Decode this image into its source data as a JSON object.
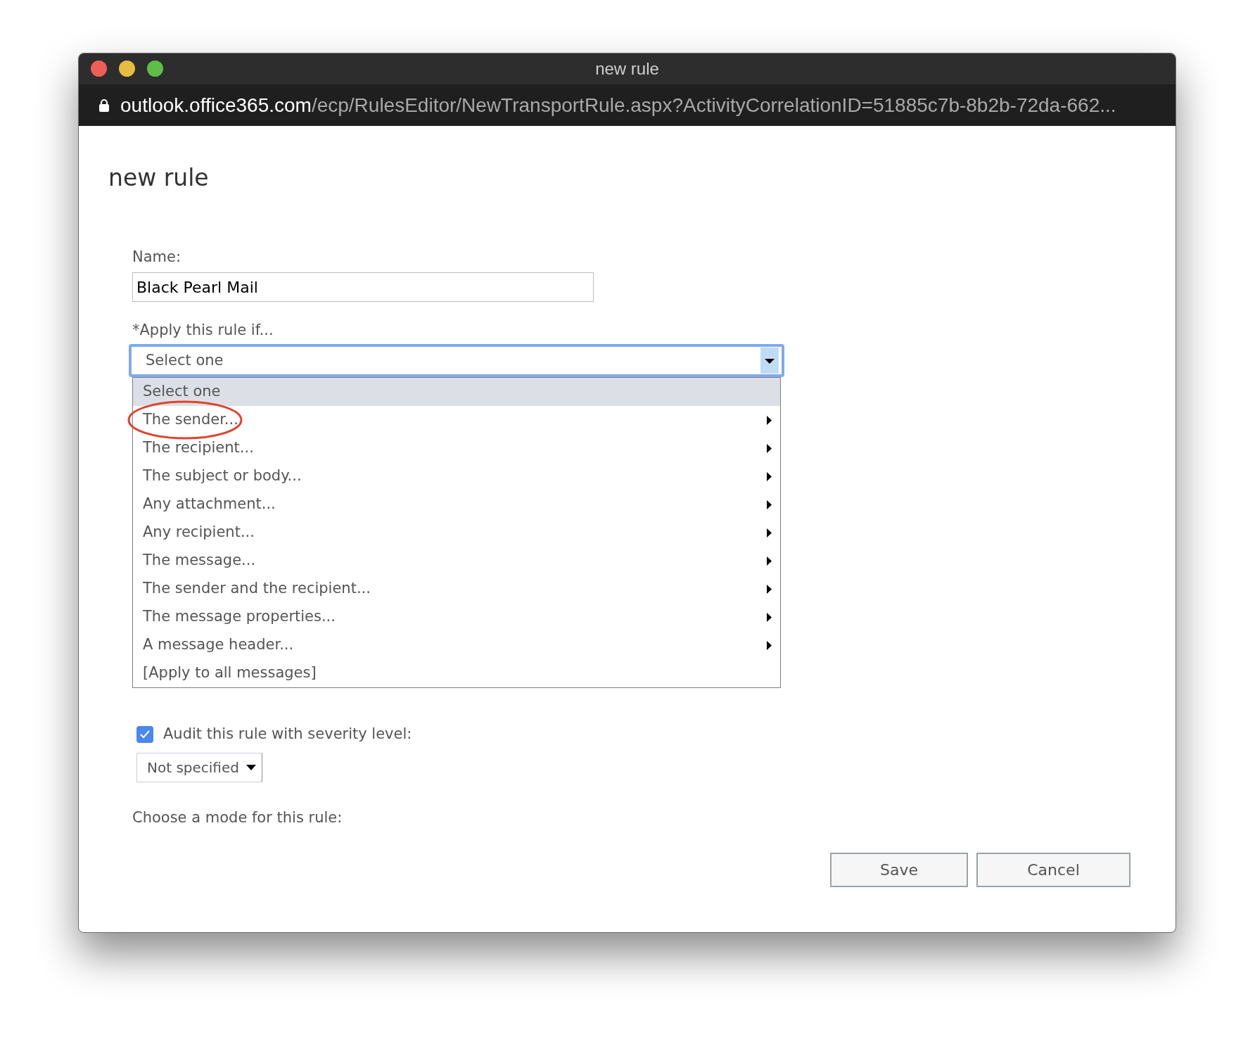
{
  "window": {
    "title": "new rule",
    "url_host": "outlook.office365.com",
    "url_path": "/ecp/RulesEditor/NewTransportRule.aspx?ActivityCorrelationID=51885c7b-8b2b-72da-662..."
  },
  "heading": "new rule",
  "name_field": {
    "label": "Name:",
    "value": "Black Pearl Mail"
  },
  "condition": {
    "label": "*Apply this rule if...",
    "value": "Select one",
    "expanded": true,
    "options": [
      {
        "label": "Select one",
        "selected": true,
        "submenu": false,
        "circled": false
      },
      {
        "label": "The sender...",
        "selected": false,
        "submenu": true,
        "circled": true
      },
      {
        "label": "The recipient...",
        "selected": false,
        "submenu": true,
        "circled": false
      },
      {
        "label": "The subject or body...",
        "selected": false,
        "submenu": true,
        "circled": false
      },
      {
        "label": "Any attachment...",
        "selected": false,
        "submenu": true,
        "circled": false
      },
      {
        "label": "Any recipient...",
        "selected": false,
        "submenu": true,
        "circled": false
      },
      {
        "label": "The message...",
        "selected": false,
        "submenu": true,
        "circled": false
      },
      {
        "label": "The sender and the recipient...",
        "selected": false,
        "submenu": true,
        "circled": false
      },
      {
        "label": "The message properties...",
        "selected": false,
        "submenu": true,
        "circled": false
      },
      {
        "label": "A message header...",
        "selected": false,
        "submenu": true,
        "circled": false
      },
      {
        "label": "[Apply to all messages]",
        "selected": false,
        "submenu": false,
        "circled": false
      }
    ]
  },
  "audit": {
    "label": "Audit this rule with severity level:",
    "checked": true,
    "severity": "Not specified"
  },
  "mode_label": "Choose a mode for this rule:",
  "buttons": [
    "Save",
    "Cancel"
  ]
}
